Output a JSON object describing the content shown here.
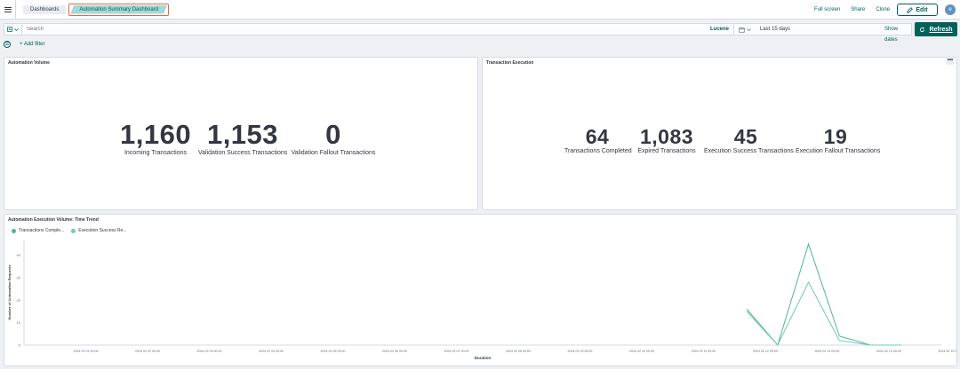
{
  "header": {
    "breadcrumbs": [
      "Dashboards",
      "Automation Summary Dashboard"
    ],
    "actions": {
      "full_screen": "Full screen",
      "share": "Share",
      "clone": "Clone",
      "edit": "Edit"
    },
    "avatar_letter": "e"
  },
  "query": {
    "search_placeholder": "Search",
    "language": "Lucene",
    "date_range": "Last 15 days",
    "show_dates": "Show dates",
    "refresh": "Refresh"
  },
  "filters": {
    "add_filter": "+ Add filter"
  },
  "panels": {
    "automation_volume": {
      "title": "Automation Volume",
      "metrics": [
        {
          "value": "1,160",
          "label": "Incoming Transactions"
        },
        {
          "value": "1,153",
          "label": "Validation Success Transactions"
        },
        {
          "value": "0",
          "label": "Validation Fallout Transactions"
        }
      ]
    },
    "transaction_execution": {
      "title": "Transaction Execution",
      "menu": "•••",
      "metrics": [
        {
          "value": "64",
          "label": "Transactions Completed"
        },
        {
          "value": "1,083",
          "label": "Expired Transactions"
        },
        {
          "value": "45",
          "label": "Execution Success Transactions"
        },
        {
          "value": "19",
          "label": "Execution Fallout Transactions"
        }
      ]
    },
    "time_trend": {
      "title": "Automation Execution Volume: Time Trend"
    }
  },
  "colors": {
    "accent": "#00615a",
    "series1": "#54b399",
    "series2": "#6dccb1"
  },
  "chart_data": {
    "type": "line",
    "title": "Automation Execution Volume: Time Trend",
    "xlabel": "Duration",
    "ylabel": "Number of Automation Requests",
    "ylim": [
      0,
      47
    ],
    "y_ticks": [
      0,
      10,
      20,
      30,
      40
    ],
    "x_tick_labels": [
      "2024 02 01 00:00",
      "2024 02 02 00:00",
      "2024 02 03 00:00",
      "2024 02 04 00:00",
      "2024 02 05 00:00",
      "2024 02 06 00:00",
      "2024 02 07 00:00",
      "2024 02 08 00:00",
      "2024 02 09 00:00",
      "2024 02 10 00:00",
      "2024 02 11 00:00",
      "2024 02 12 00:00",
      "2024 02 13 00:00",
      "2024 02 14 00:00",
      "2024 02 15 00:00"
    ],
    "grid": false,
    "legend": "top-left",
    "series": [
      {
        "name": "Transactions Comple...",
        "color": "#54b399",
        "x": [
          11.7,
          12.2,
          12.7,
          13.2,
          13.7,
          14.2
        ],
        "values": [
          16,
          0,
          45,
          4,
          0,
          0
        ]
      },
      {
        "name": "Execution Success Re...",
        "color": "#6dccb1",
        "x": [
          11.7,
          12.2,
          12.7,
          13.2,
          13.7,
          14.2
        ],
        "values": [
          15,
          0,
          28,
          2,
          0,
          0
        ]
      }
    ]
  }
}
